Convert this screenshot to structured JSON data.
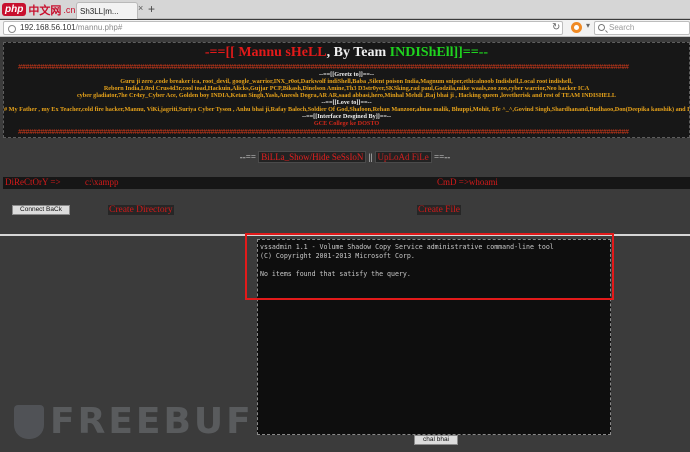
{
  "browser": {
    "watermark_logo": "php",
    "watermark_cn": "中文网",
    "watermark_domain": ".cn",
    "tab_title": "Sh3LL|m...",
    "tab_close": "×",
    "new_tab": "+",
    "url_host": "192.168.56.101",
    "url_path": "/mannu.php#",
    "search_placeholder": "Search"
  },
  "header": {
    "title_prefix": "-==[[ ",
    "title_name": "Mannu sHeLL",
    "title_mid": ", By Team ",
    "title_team": "INDIShEll",
    "title_suffix": "]]==--",
    "hash_line": "#####################################################################################################################################################################",
    "greetz_title": "--==[[Greetz to]]==--",
    "greetz_line1": "Guru ji zero ,code breaker ica, root_devil, google_warrior,INX_r0ot,Darkwolf indiShell,Baba ,Silent poison India,Magnum sniper,ethicalnoob Indishell,Local root indishell,",
    "greetz_line2": "Reborn India,L0rd Crus4d3r,cool toad,Hackuin,Alicks,Gujjar PCP,Bikash,Dinelson Amine,Th3 D3str0yer,SKSking,rad paul,Godzila,mike waals,zoo zoo,cyber warrior,Neo hacker ICA",
    "greetz_line3": "cyber gladiator,7he Cr4zy_Cyber Ace, Golden boy INDIA,Ketan Singh,Yash,Aneesh Dogra,AR AR,saad abbasi,hero,Minhal Mehdi ,Raj bhai ji , Hacking queen ,lovetherisk and rest of TEAM INDISHELL",
    "love_title": "--==[[Love to]]==--",
    "love_line": "# My Father , my Ex Teacher,cold fire hacker,Mannu, ViKi,jagriti,Suriya Cyber Tyson , Anhu bhai ji,Rafay Baloch,Soldier Of God,Shafoon,Rehan Manzoor,almas malik, Bhuppi,Mohit, Ffe ^_^,Govind Singh,Shardhanand,Budhaoo,Don(Deepika kaushik) and D",
    "designer": "--==[[Interface Desgined By]]==--",
    "designer_name": "GCE College ke DOSTO"
  },
  "menu": {
    "lead": "--==",
    "show_hide_label": "BiLLa_Show/Hide SeSsIoN",
    "separator": "||",
    "upload_label": "UpLoAd FiLe",
    "trail": "==--"
  },
  "info": {
    "directory_label": "DiReCtOrY =>",
    "directory_value": "c:\\xampp",
    "cmd_label": "CmD =>whoami"
  },
  "actions": {
    "connect_back": "Connect BaCk",
    "create_directory": "Create Directory",
    "create_file": "Create File"
  },
  "console": {
    "line1": "vssadmin 1.1 - Volume Shadow Copy Service administrative command-line tool",
    "line2": "(C) Copyright 2001-2013 Microsoft Corp.",
    "line3": "",
    "line4": "No items found that satisfy the query."
  },
  "exec_button": "chal bhai",
  "watermark": "FREEBUF"
}
